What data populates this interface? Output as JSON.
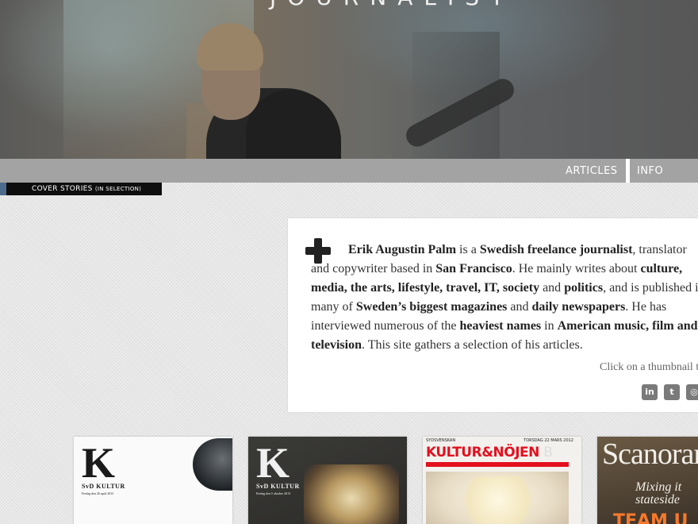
{
  "header": {
    "site_title": "JOURNALIST"
  },
  "nav": {
    "articles": "ARTICLES",
    "info": "INFO"
  },
  "cover_tag": {
    "main": "COVER STORIES",
    "small": "(IN SELECTION)"
  },
  "intro": {
    "name": "Erik Augustin Palm",
    "t1": " is a ",
    "role": "Swedish freelance journalist",
    "t2": ", translator and copywriter based in ",
    "city": "San Francisco",
    "t3": ". He mainly writes about ",
    "topics1": "culture, media, the arts, lifestyle, travel, IT, society",
    "t4": " and ",
    "topics2": "politics",
    "t5": ", and is published in many of ",
    "mags": "Sweden’s biggest magazines",
    "t6": " and ",
    "papers": "daily newspapers",
    "t7": ". He has interviewed numerous of the ",
    "names": "heaviest names",
    "t8": " in ",
    "fields": "American music, film and television",
    "t9": ". This site gathers a selection of his articles.",
    "click_hint": "Click on a thumbnail to read"
  },
  "social": {
    "linkedin": "in",
    "twitter": "t",
    "instagram": "◎"
  },
  "thumbnails": [
    {
      "mark": "K",
      "sub": "SvD KULTUR",
      "date": "Fredag den 26 april 2013"
    },
    {
      "mark": "K",
      "sub": "SvD KULTUR",
      "date": "Fredag den 5 oktober 2013"
    },
    {
      "top_left": "SYDSVENSKAN",
      "top_right": "TORSDAG 22 MARS 2012",
      "title": "KULTUR&NÖJEN",
      "letter": "B"
    },
    {
      "title": "Scanorama",
      "sub1": "Mixing it",
      "sub2": "stateside",
      "team": "TEAM U"
    }
  ],
  "colors": {
    "nav_bg": "#a3a3a3",
    "tag_accent": "#4d6a8c",
    "kn_red": "#e3101e"
  }
}
